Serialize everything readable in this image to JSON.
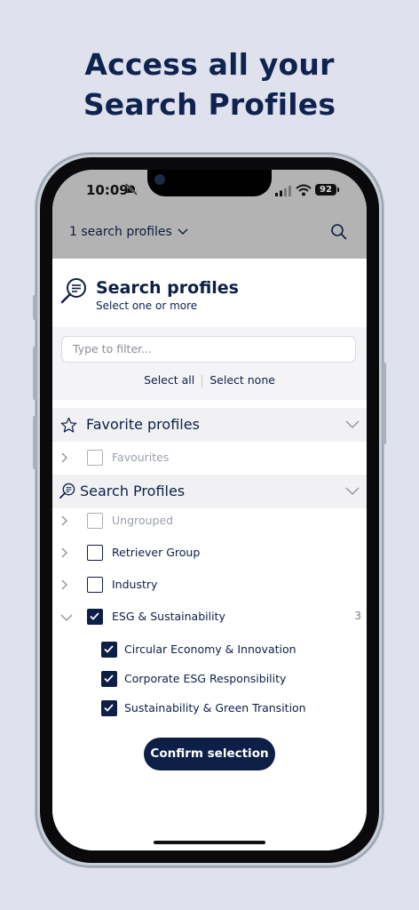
{
  "headline": {
    "line1": "Access all your",
    "line2": "Search Profiles"
  },
  "status_bar": {
    "time": "10:09",
    "battery": "92"
  },
  "top_bar": {
    "profiles_dropdown": "1 search profiles"
  },
  "sheet": {
    "title": "Search profiles",
    "subtitle": "Select one or more",
    "filter_placeholder": "Type to filter...",
    "select_all": "Select all",
    "select_none": "Select none"
  },
  "sections": {
    "favorites": {
      "title": "Favorite profiles",
      "items": [
        {
          "label": "Favourites",
          "checked": false,
          "disabled": true
        }
      ]
    },
    "search_profiles": {
      "title": "Search Profiles",
      "items": [
        {
          "label": "Ungrouped",
          "checked": false,
          "disabled": true
        },
        {
          "label": "Retriever Group",
          "checked": false
        },
        {
          "label": "Industry",
          "checked": false
        },
        {
          "label": "ESG & Sustainability",
          "checked": true,
          "expanded": true,
          "count": "3"
        }
      ],
      "children": [
        {
          "label": "Circular Economy & Innovation",
          "checked": true
        },
        {
          "label": "Corporate ESG Responsibility",
          "checked": true
        },
        {
          "label": "Sustainability & Green Transition",
          "checked": true
        }
      ]
    }
  },
  "confirm_button": "Confirm selection",
  "colors": {
    "navy": "#0d1f47",
    "background": "#dfe2ed",
    "overlay": "#b3b3b3"
  }
}
